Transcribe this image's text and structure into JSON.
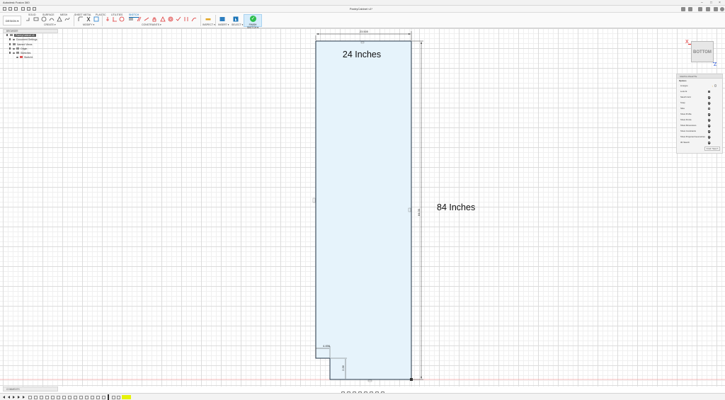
{
  "window": {
    "title": "Autodesk Fusion 360",
    "document_tab": "PantryCabinet v1*"
  },
  "workspace_tabs": [
    "SOLID",
    "SURFACE",
    "MESH",
    "SHEET METAL",
    "PLASTIC",
    "UTILITIES",
    "SKETCH"
  ],
  "active_tab": "SKETCH",
  "design_button": "DESIGN ▾",
  "toolbar_groups": {
    "create": "CREATE ▾",
    "modify": "MODIFY ▾",
    "constraints": "CONSTRAINTS ▾",
    "inspect": "INSPECT ▾",
    "insert": "INSERT ▾",
    "select": "SELECT ▾",
    "finish": "FINISH SKETCH ▾"
  },
  "browser": {
    "header": "BROWSER",
    "items": [
      {
        "label": "PantryCabinet v1",
        "kind": "root"
      },
      {
        "label": "Document Settings",
        "kind": "gear"
      },
      {
        "label": "Named Views",
        "kind": "folder"
      },
      {
        "label": "Origin",
        "kind": "folder"
      },
      {
        "label": "Sketches",
        "kind": "folder"
      },
      {
        "label": "Sketch1",
        "kind": "sketch"
      }
    ]
  },
  "viewcube": {
    "face": "BOTTOM",
    "x_label": "X",
    "z_label": "Z"
  },
  "sketch_palette": {
    "header": "SKETCH PALETTE",
    "section": "Options",
    "options": [
      {
        "label": "Linetype",
        "checked": null
      },
      {
        "label": "Look At",
        "checked": null
      },
      {
        "label": "Sketch Grid",
        "checked": true
      },
      {
        "label": "Snap",
        "checked": true
      },
      {
        "label": "Slice",
        "checked": false
      },
      {
        "label": "Show Profile",
        "checked": true
      },
      {
        "label": "Show Points",
        "checked": true
      },
      {
        "label": "Show Dimensions",
        "checked": true
      },
      {
        "label": "Show Constraints",
        "checked": true
      },
      {
        "label": "Show Projected Geometries",
        "checked": true
      },
      {
        "label": "3D Sketch",
        "checked": true
      }
    ],
    "finish_button": "Finish Sketch"
  },
  "sketch": {
    "annotation_width": "24 Inches",
    "annotation_height": "84 Inches",
    "dim_width": "23.500",
    "dim_height": "84.00",
    "dim_notch_width": "4.456",
    "dim_notch_height": "2.36"
  },
  "comments_label": "COMMENTS",
  "colors": {
    "accent": "#0a6db8",
    "finish_green": "#2dbe4e",
    "profile_fill": "#e6f3fb",
    "sketch_line": "#223344",
    "axis_red": "#e02020",
    "axis_blue": "#1e4ed8"
  }
}
